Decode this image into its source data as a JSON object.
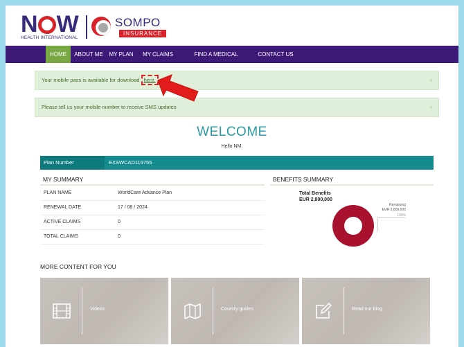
{
  "header": {
    "logo_now": "NOW",
    "logo_now_sub": "HEALTH INTERNATIONAL",
    "logo_sompo": "SOMPO",
    "logo_sompo_sub": "INSURANCE"
  },
  "nav": {
    "items": [
      {
        "label": "HOME",
        "active": true
      },
      {
        "label": "ABOUT ME",
        "active": false
      },
      {
        "label": "MY PLAN",
        "active": false
      },
      {
        "label": "MY CLAIMS",
        "active": false
      },
      {
        "label": "FIND A MEDICAL PROVIDER",
        "active": false
      },
      {
        "label": "CONTACT US",
        "active": false
      }
    ]
  },
  "alerts": [
    {
      "text": "Your mobile pass is available for download ",
      "link": "here.",
      "close": "×"
    },
    {
      "text": "Please tell us your mobile number to receive SMS updates",
      "close": "×"
    }
  ],
  "welcome": {
    "title": "WELCOME",
    "greeting": "Hello NM."
  },
  "plan": {
    "label": "Plan Number",
    "value": "EXSWCAD119755"
  },
  "summary": {
    "title": "MY SUMMARY",
    "rows": [
      {
        "key": "PLAN NAME",
        "value": "WorldCare Advance Plan"
      },
      {
        "key": "RENEWAL DATE",
        "value": "17 / 08 / 2024"
      },
      {
        "key": "ACTIVE CLAIMS",
        "value": "0"
      },
      {
        "key": "TOTAL CLAIMS",
        "value": "0"
      }
    ]
  },
  "benefits": {
    "title": "BENEFITS SUMMARY",
    "total_label": "Total Benefits",
    "total_amount": "EUR 2,800,000",
    "remaining_label": "Remaining",
    "remaining_amount": "EUR 2,800,000",
    "remaining_pct": "100%",
    "remaining_fraction": 1.0,
    "color": "#a8122e"
  },
  "more": {
    "title": "MORE CONTENT FOR YOU",
    "tiles": [
      {
        "label": "Videos",
        "icon": "film-icon"
      },
      {
        "label": "Country guides",
        "icon": "map-icon"
      },
      {
        "label": "Read our blog",
        "icon": "edit-icon"
      }
    ]
  },
  "colors": {
    "nav_bg": "#3d1a78",
    "nav_active": "#7aa842",
    "accent": "#2a9aa4",
    "plan_bar": "#138b8f",
    "alert_bg": "#e0efd9"
  }
}
